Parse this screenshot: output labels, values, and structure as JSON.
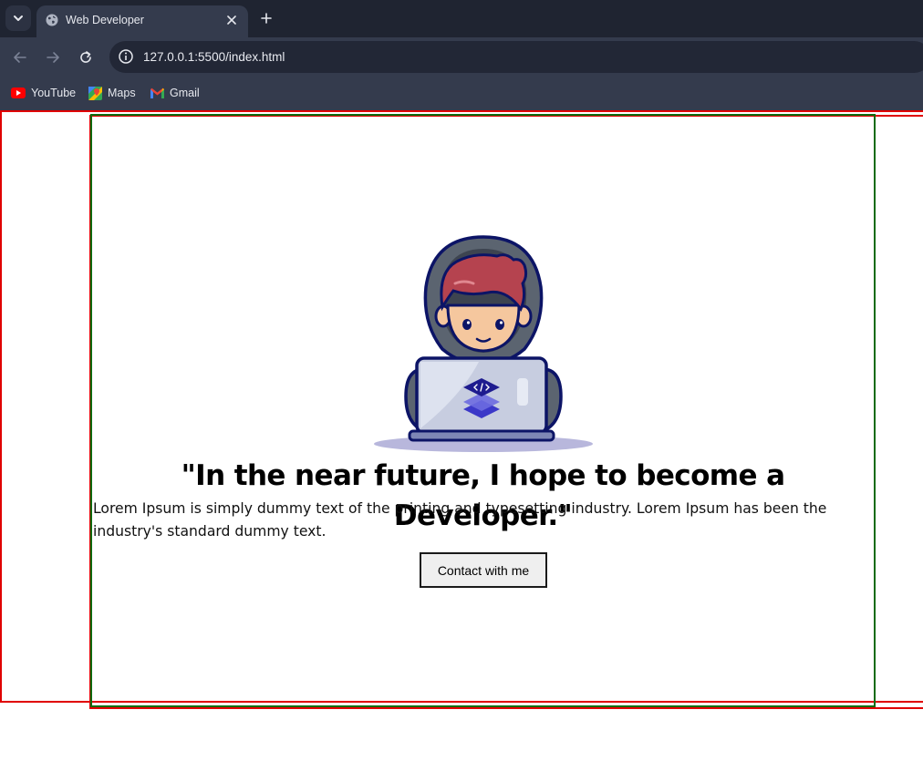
{
  "browser": {
    "tab_title": "Web Developer",
    "url": "127.0.0.1:5500/index.html",
    "bookmarks": [
      {
        "label": "YouTube",
        "icon": "youtube-icon"
      },
      {
        "label": "Maps",
        "icon": "maps-icon"
      },
      {
        "label": "Gmail",
        "icon": "gmail-icon"
      }
    ]
  },
  "page": {
    "heading": "\"In the near future, I hope to become a Developer.\"",
    "paragraph": "Lorem Ipsum is simply dummy text of the printing and typesetting industry. Lorem Ipsum has been the industry's standard dummy text.",
    "button_label": "Contact with me",
    "illustration": "developer-with-laptop-illustration",
    "laptop_logo": "code-layers-icon"
  },
  "colors": {
    "chrome_dark": "#1f2431",
    "chrome_toolbar": "#343b4d",
    "outline_red": "#e00000",
    "outline_green": "#0f6b0f",
    "hoodie": "#5b6470",
    "hair": "#b5434f",
    "skin": "#f5c79e",
    "laptop": "#c7cde0",
    "logo": "#3b38c8",
    "outline": "#0c1466"
  }
}
